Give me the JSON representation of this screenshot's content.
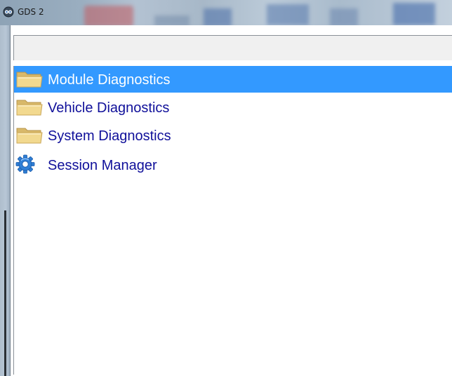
{
  "window": {
    "title": "GDS 2"
  },
  "tree": {
    "items": [
      {
        "label": "Module Diagnostics",
        "icon": "folder-icon",
        "selected": true
      },
      {
        "label": "Vehicle Diagnostics",
        "icon": "folder-icon",
        "selected": false
      },
      {
        "label": "System Diagnostics",
        "icon": "folder-icon",
        "selected": false
      },
      {
        "label": "Session Manager",
        "icon": "gear-icon",
        "selected": false
      }
    ]
  },
  "colors": {
    "selection": "#3399ff",
    "item_text": "#10109a",
    "toolbar_bg": "#f0f0f0"
  }
}
